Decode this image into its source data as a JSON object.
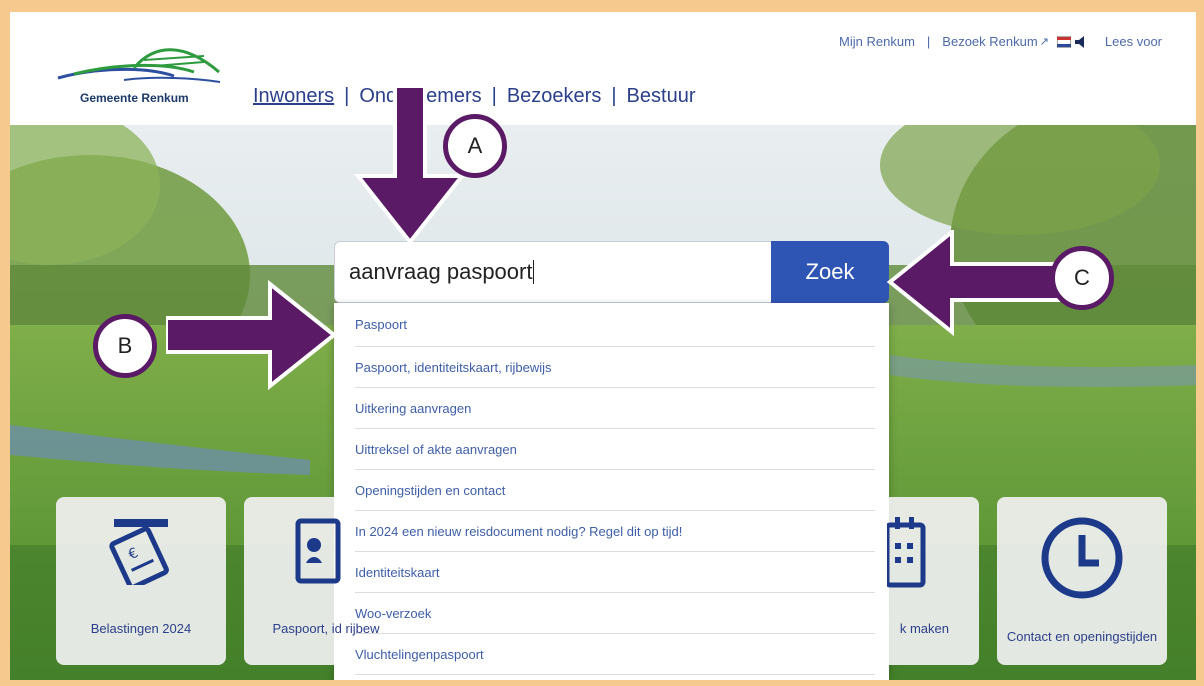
{
  "header": {
    "logo_text": "Gemeente Renkum",
    "nav": [
      {
        "label": "Inwoners"
      },
      {
        "label": "Ondernemers"
      },
      {
        "label": "Bezoekers"
      },
      {
        "label": "Bestuur"
      }
    ],
    "top_links": {
      "mijn": "Mijn Renkum",
      "bezoek": "Bezoek Renkum",
      "read_aloud": "Lees voor"
    }
  },
  "search": {
    "value": "aanvraag paspoort",
    "button": "Zoek"
  },
  "suggestions": [
    "Paspoort",
    "Paspoort, identiteitskaart, rijbewijs",
    "Uitkering aanvragen",
    "Uittreksel of akte aanvragen",
    "Openingstijden en contact",
    "In 2024 een nieuw reisdocument nodig? Regel dit op tijd!",
    "Identiteitskaart",
    "Woo-verzoek",
    "Vluchtelingenpaspoort"
  ],
  "tiles": [
    {
      "label": "Belastingen 2024",
      "icon": "tax-card-icon"
    },
    {
      "label": "Paspoort, id rijbew",
      "icon": "passport-icon"
    },
    {
      "label": "k maken",
      "icon": "calendar-icon"
    },
    {
      "label": "Contact en openingstijden",
      "icon": "clock-icon"
    }
  ],
  "annotations": {
    "a": "A",
    "b": "B",
    "c": "C"
  },
  "colors": {
    "brand_blue": "#2b3f8a",
    "button_blue": "#2f55b4",
    "annotation_purple": "#5a1a66",
    "frame_orange": "#f6c98f"
  }
}
